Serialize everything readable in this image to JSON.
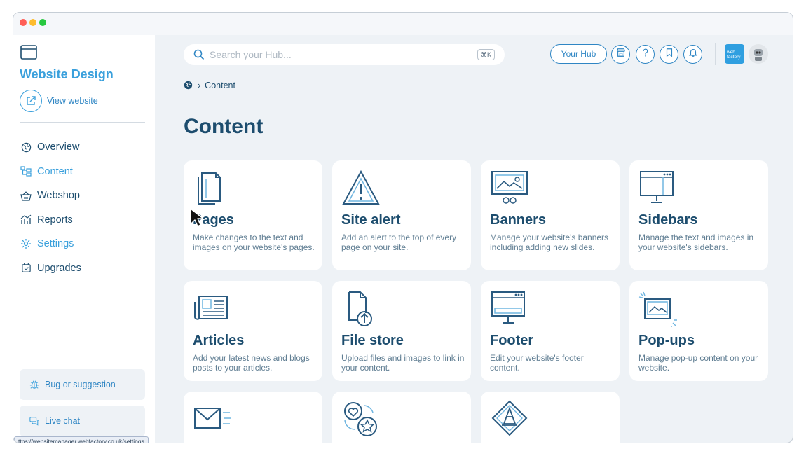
{
  "sidebar": {
    "title": "Website Design",
    "view_website": "View website",
    "items": [
      {
        "label": "Overview",
        "icon": "globe-icon"
      },
      {
        "label": "Content",
        "icon": "content-tree-icon",
        "active": true
      },
      {
        "label": "Webshop",
        "icon": "basket-icon"
      },
      {
        "label": "Reports",
        "icon": "chart-icon"
      },
      {
        "label": "Settings",
        "icon": "gear-icon",
        "active": true
      },
      {
        "label": "Upgrades",
        "icon": "calendar-check-icon"
      }
    ],
    "bug_label": "Bug or suggestion",
    "chat_label": "Live chat"
  },
  "header": {
    "search_placeholder": "Search your Hub...",
    "shortcut": "⌘K",
    "hub_label": "Your Hub",
    "icons": [
      "store-icon",
      "help-icon",
      "bookmark-icon",
      "bell-icon"
    ],
    "logo_text": "web factory"
  },
  "breadcrumb": {
    "current": "Content"
  },
  "main": {
    "title": "Content",
    "cards": [
      {
        "title": "Pages",
        "desc": "Make changes to the text and images on your website's pages.",
        "icon": "pages-icon"
      },
      {
        "title": "Site alert",
        "desc": "Add an alert to the top of every page on your site.",
        "icon": "alert-icon"
      },
      {
        "title": "Banners",
        "desc": "Manage your website's banners including adding new slides.",
        "icon": "banner-icon"
      },
      {
        "title": "Sidebars",
        "desc": "Manage the text and images in your website's sidebars.",
        "icon": "sidebar-monitor-icon"
      },
      {
        "title": "Articles",
        "desc": "Add your latest news and blogs posts to your articles.",
        "icon": "newspaper-icon"
      },
      {
        "title": "File store",
        "desc": "Upload files and images to link in your content.",
        "icon": "file-upload-icon"
      },
      {
        "title": "Footer",
        "desc": "Edit your website's footer content.",
        "icon": "footer-monitor-icon"
      },
      {
        "title": "Pop-ups",
        "desc": "Manage pop-up content on your website.",
        "icon": "popup-icon"
      },
      {
        "title": "",
        "desc": "",
        "icon": "email-icon"
      },
      {
        "title": "",
        "desc": "",
        "icon": "social-icon"
      },
      {
        "title": "",
        "desc": "",
        "icon": "cone-icon"
      }
    ]
  },
  "status_url": "ttps://websitemanager.webfactory.co.uk/settings",
  "colors": {
    "accent": "#3aa0dc",
    "navy": "#1d4d6e",
    "background": "#eef2f6",
    "logo": "#2f9fe0"
  }
}
